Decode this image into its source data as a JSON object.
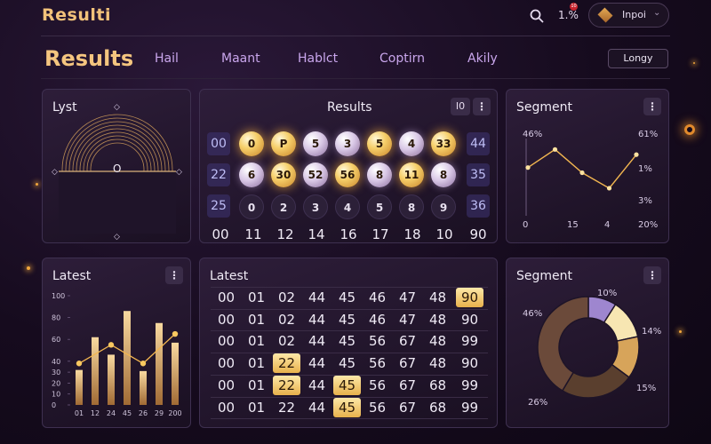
{
  "header": {
    "brand": "Resulti",
    "pct": "1.%",
    "notif": "10",
    "user_name": "Inpoi",
    "icons": {
      "search": "search-icon",
      "chevron": "chevron-down-icon",
      "avatar": "avatar-icon"
    }
  },
  "nav": {
    "page_title": "Results",
    "items": [
      "Hail",
      "Maant",
      "Hablct",
      "Coptirn",
      "Akily"
    ],
    "button": "Longy"
  },
  "panels": {
    "lyst": {
      "title": "Lyst",
      "center": "O"
    },
    "results": {
      "title": "Results",
      "tag": "I0",
      "left_col": [
        "00",
        "22",
        "25"
      ],
      "right_col": [
        "44",
        "35",
        "36"
      ],
      "row1": [
        {
          "label": "0",
          "style": "gold"
        },
        {
          "label": "P",
          "style": "gold"
        },
        {
          "label": "5",
          "style": "pearl"
        },
        {
          "label": "3",
          "style": "pearl"
        },
        {
          "label": "5",
          "style": "gold"
        },
        {
          "label": "4",
          "style": "pearl"
        },
        {
          "label": "33",
          "style": "gold"
        }
      ],
      "row2": [
        {
          "label": "6",
          "style": "pearl"
        },
        {
          "label": "30",
          "style": "gold"
        },
        {
          "label": "52",
          "style": "pearl"
        },
        {
          "label": "56",
          "style": "gold"
        },
        {
          "label": "8",
          "style": "pearl"
        },
        {
          "label": "11",
          "style": "gold"
        },
        {
          "label": "8",
          "style": "pearl"
        }
      ],
      "row3": [
        "0",
        "2",
        "3",
        "4",
        "5",
        "8",
        "9"
      ],
      "bottom": [
        "00",
        "11",
        "12",
        "14",
        "16",
        "17",
        "18",
        "10",
        "90"
      ]
    },
    "segment_line": {
      "title": "Segment",
      "left_labels": [
        "46%",
        "0"
      ],
      "right_labels": [
        "61%",
        "1%",
        "3%",
        "20%"
      ],
      "bottom_labels": [
        "15",
        "4"
      ]
    },
    "latest_bar": {
      "title": "Latest"
    },
    "latest_table": {
      "title": "Latest",
      "rows": [
        [
          "00",
          "01",
          "02",
          "44",
          "45",
          "46",
          "47",
          "48",
          "90"
        ],
        [
          "00",
          "01",
          "02",
          "44",
          "45",
          "46",
          "47",
          "48",
          "90"
        ],
        [
          "00",
          "01",
          "02",
          "44",
          "45",
          "56",
          "67",
          "48",
          "99"
        ],
        [
          "00",
          "01",
          "22",
          "44",
          "45",
          "56",
          "67",
          "48",
          "90"
        ],
        [
          "00",
          "01",
          "22",
          "44",
          "45",
          "56",
          "67",
          "68",
          "99"
        ],
        [
          "00",
          "01",
          "22",
          "44",
          "45",
          "56",
          "67",
          "68",
          "99"
        ]
      ],
      "highlight": [
        [
          0,
          8
        ],
        [
          3,
          2
        ],
        [
          4,
          2
        ],
        [
          4,
          4
        ],
        [
          5,
          4
        ]
      ]
    },
    "segment_donut": {
      "title": "Segment",
      "labels": [
        "10%",
        "14%",
        "15%",
        "26%",
        "46%"
      ]
    }
  },
  "chart_data": [
    {
      "type": "bar",
      "title": "Latest",
      "categories": [
        "01",
        "12",
        "24",
        "45",
        "26",
        "29",
        "200"
      ],
      "values": [
        32,
        62,
        46,
        86,
        31,
        75,
        57
      ],
      "line_values": [
        38,
        0,
        55,
        0,
        38,
        0,
        65
      ],
      "ylim": [
        0,
        100
      ],
      "yticks": [
        0,
        10,
        20,
        30,
        40,
        60,
        80,
        100
      ]
    },
    {
      "type": "line",
      "title": "Segment",
      "x": [
        0,
        1,
        2,
        3,
        4
      ],
      "y": [
        56,
        77,
        50,
        32,
        71
      ],
      "accent": "#f2b650"
    },
    {
      "type": "pie",
      "title": "Segment",
      "values": [
        10,
        14,
        15,
        26,
        46
      ],
      "colors": [
        "#9e86cf",
        "#f7e6b2",
        "#d7a45a",
        "#5a3f2e",
        "#6b4a3a"
      ]
    }
  ],
  "colors": {
    "accent": "#f4c57f",
    "nav": "#c9a6ec",
    "panel_border": "#3e3050"
  }
}
